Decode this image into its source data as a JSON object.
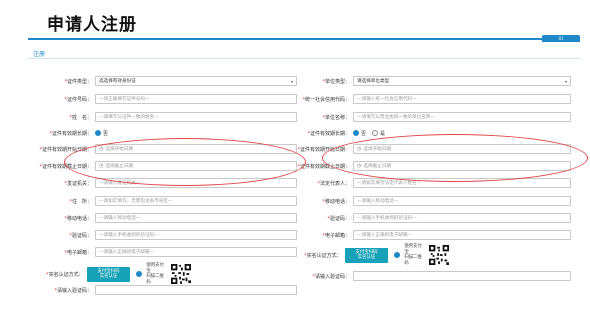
{
  "page": {
    "title": "申请人注册",
    "tab_label": "01",
    "section": "注册"
  },
  "left_form": {
    "id_type": {
      "label": "证件类型：",
      "value": "选选择有效身份证",
      "caret": "▾"
    },
    "id_number": {
      "label": "证件号码：",
      "placeholder": "—请正确填写证件号码—"
    },
    "name": {
      "label": "姓　名：",
      "placeholder": "—请填写与证件一致的姓名—"
    },
    "long_term": {
      "label": "证件有效期长期：",
      "options": [
        "否"
      ]
    },
    "valid_start": {
      "label": "证件有效期开始日期：",
      "placeholder": "选择开始日期"
    },
    "valid_end": {
      "label": "证件有效期截止日期：",
      "placeholder": "选择截止日期"
    },
    "issuing_authority": {
      "label": "发证机关：",
      "placeholder": "—请输入发证机关—"
    },
    "address": {
      "label": "住　所：",
      "placeholder": "—请如实填写，无需包含省市县区—"
    },
    "mobile": {
      "label": "移动电话：",
      "placeholder": "—请输入移动电话—"
    },
    "verify_code": {
      "label": "验证码：",
      "placeholder": "—请输入手机收到的验证码—"
    },
    "email": {
      "label": "电子邮箱：",
      "placeholder": "—请输入正确的电子邮箱—"
    },
    "real_name_method": {
      "label": "实名认证方式：",
      "button_line1": "支付宝扫码",
      "button_line2": "实名认证",
      "scan_line1": "使用支付宝",
      "scan_line2": "扫描二维码"
    },
    "enter_login_code": {
      "label": "请输入验证码："
    }
  },
  "right_form": {
    "unit_type": {
      "label": "单位类型：",
      "value": "请选择单位类型",
      "caret": "▾"
    },
    "unit_code": {
      "label": "统一社会信用代码：",
      "placeholder": "—请输入统一社会信用代码—"
    },
    "unit_name": {
      "label": "单位名称：",
      "placeholder": "—请填写与营业执照一致的单位名称—"
    },
    "long_term": {
      "label": "证件有效期长期：",
      "options": [
        "否",
        "是"
      ]
    },
    "valid_start": {
      "label": "证件有效期开始日期：",
      "placeholder": "选择开始日期"
    },
    "valid_end": {
      "label": "证件有效期截止日期：",
      "placeholder": "选择截止日期"
    },
    "legal_name": {
      "label": "法定代表人：",
      "placeholder": "—请如实填写法定代表人姓名—"
    },
    "mobile": {
      "label": "移动电话：",
      "placeholder": "—请输入移动电话—"
    },
    "verify_code": {
      "label": "验证码：",
      "placeholder": "—请输入手机收到的验证码—"
    },
    "email": {
      "label": "电子邮箱：",
      "placeholder": "—请输入正确的电子邮箱—"
    },
    "real_name_method": {
      "label": "实名认证方式：",
      "button_line1": "支付宝扫码",
      "button_line2": "实名认证",
      "scan_line1": "使用支付宝",
      "scan_line2": "扫描二维码"
    },
    "enter_login_code": {
      "label": "请输入验证码："
    }
  },
  "colors": {
    "accent": "#1e88c8",
    "annotation": "#e04646",
    "button": "#17a2b8"
  }
}
